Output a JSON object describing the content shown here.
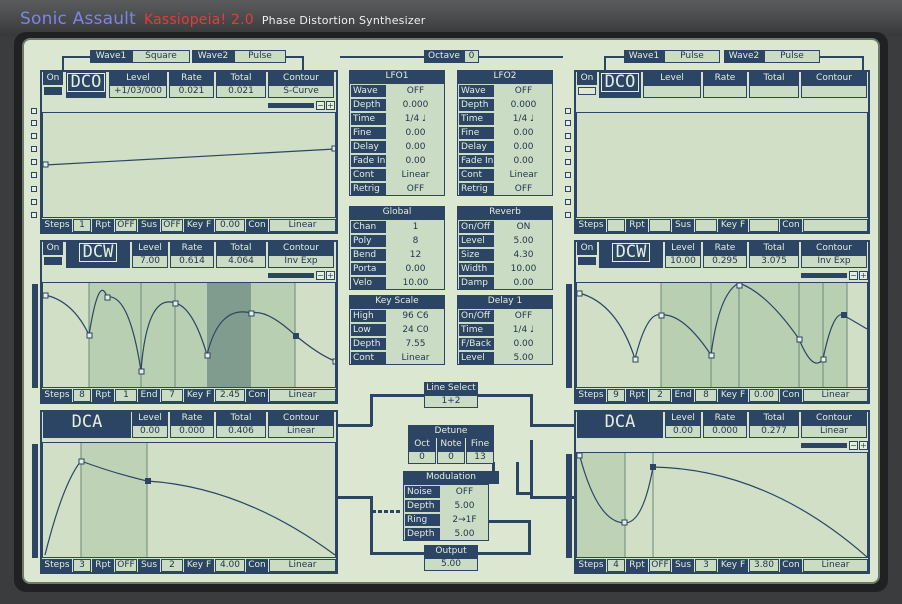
{
  "brand": {
    "name": "Sonic Assault",
    "product": "Kassiopeia! 2.0",
    "subtitle": "Phase Distortion Synthesizer"
  },
  "left_wave": {
    "wave1_label": "Wave1",
    "wave1_value": "Square",
    "wave2_label": "Wave2",
    "wave2_value": "Pulse"
  },
  "right_wave": {
    "wave1_label": "Wave1",
    "wave1_value": "Pulse",
    "wave2_label": "Wave2",
    "wave2_value": "Pulse"
  },
  "octave": {
    "label": "Octave",
    "value": "0"
  },
  "headers": {
    "on": "On",
    "level": "Level",
    "rate": "Rate",
    "total": "Total",
    "contour": "Contour"
  },
  "steps_labels": {
    "steps": "Steps",
    "rpt": "Rpt",
    "sus": "Sus",
    "end": "End",
    "keyf": "Key F",
    "con": "Con"
  },
  "dco_left": {
    "title": "DCO",
    "level": "+1/03/000",
    "rate": "0.021",
    "total": "0.021",
    "contour": "S-Curve",
    "steps": "1",
    "rpt": "OFF",
    "sus": "OFF",
    "keyf": "0.00",
    "con": "Linear"
  },
  "dcw_left": {
    "title": "DCW",
    "level": "7.00",
    "rate": "0.614",
    "total": "4.064",
    "contour": "Inv Exp",
    "steps": "8",
    "rpt": "1",
    "end": "7",
    "keyf": "2.45",
    "con": "Linear"
  },
  "dca_left": {
    "title": "DCA",
    "level": "0.00",
    "rate": "0.000",
    "total": "0.406",
    "contour": "Linear",
    "steps": "3",
    "rpt": "OFF",
    "sus": "2",
    "keyf": "4.00",
    "con": "Linear"
  },
  "dco_right": {
    "title": "DCO"
  },
  "dcw_right": {
    "title": "DCW",
    "level": "10.00",
    "rate": "0.295",
    "total": "3.075",
    "contour": "Inv Exp",
    "steps": "9",
    "rpt": "2",
    "end": "8",
    "keyf": "0.00",
    "con": "Linear"
  },
  "dca_right": {
    "title": "DCA",
    "level": "0.00",
    "rate": "0.000",
    "total": "0.277",
    "contour": "Linear",
    "steps": "4",
    "rpt": "OFF",
    "sus": "3",
    "keyf": "3.80",
    "con": "Linear"
  },
  "lfo1": {
    "title": "LFO1",
    "rows": [
      [
        "Wave",
        "OFF"
      ],
      [
        "Depth",
        "0.000"
      ],
      [
        "Time",
        "1/4 ♩"
      ],
      [
        "Fine",
        "0.00"
      ],
      [
        "Delay",
        "0.00"
      ],
      [
        "Fade In",
        "0.00"
      ],
      [
        "Cont",
        "Linear"
      ],
      [
        "Retrig",
        "OFF"
      ]
    ]
  },
  "lfo2": {
    "title": "LFO2",
    "rows": [
      [
        "Wave",
        "OFF"
      ],
      [
        "Depth",
        "0.000"
      ],
      [
        "Time",
        "1/4 ♩"
      ],
      [
        "Fine",
        "0.00"
      ],
      [
        "Delay",
        "0.00"
      ],
      [
        "Fade In",
        "0.00"
      ],
      [
        "Cont",
        "Linear"
      ],
      [
        "Retrig",
        "OFF"
      ]
    ]
  },
  "global": {
    "title": "Global",
    "rows": [
      [
        "Chan",
        "1"
      ],
      [
        "Poly",
        "8"
      ],
      [
        "Bend",
        "12"
      ],
      [
        "Porta",
        "0.00"
      ],
      [
        "Velo",
        "10.00"
      ]
    ]
  },
  "reverb": {
    "title": "Reverb",
    "rows": [
      [
        "On/Off",
        "ON"
      ],
      [
        "Level",
        "5.00"
      ],
      [
        "Size",
        "4.30"
      ],
      [
        "Width",
        "10.00"
      ],
      [
        "Damp",
        "0.00"
      ]
    ]
  },
  "keyscale": {
    "title": "Key Scale",
    "rows": [
      [
        "High",
        "96 C6"
      ],
      [
        "Low",
        "24 C0"
      ],
      [
        "Depth",
        "7.55"
      ],
      [
        "Cont",
        "Linear"
      ]
    ]
  },
  "delay1": {
    "title": "Delay 1",
    "rows": [
      [
        "On/Off",
        "OFF"
      ],
      [
        "Time",
        "1/4 ♩"
      ],
      [
        "F/Back",
        "0.00"
      ],
      [
        "Level",
        "5.00"
      ]
    ]
  },
  "line_select": {
    "label": "Line Select",
    "value": "1+2"
  },
  "detune": {
    "label": "Detune",
    "oct_label": "Oct",
    "note_label": "Note",
    "fine_label": "Fine",
    "oct": "0",
    "note": "0",
    "fine": "13"
  },
  "modulation": {
    "label": "Modulation",
    "rows": [
      [
        "Noise",
        "OFF"
      ],
      [
        "Depth",
        "5.00"
      ],
      [
        "Ring",
        "2→1F"
      ],
      [
        "Depth",
        "5.00"
      ]
    ]
  },
  "output": {
    "label": "Output",
    "value": "5.00"
  }
}
